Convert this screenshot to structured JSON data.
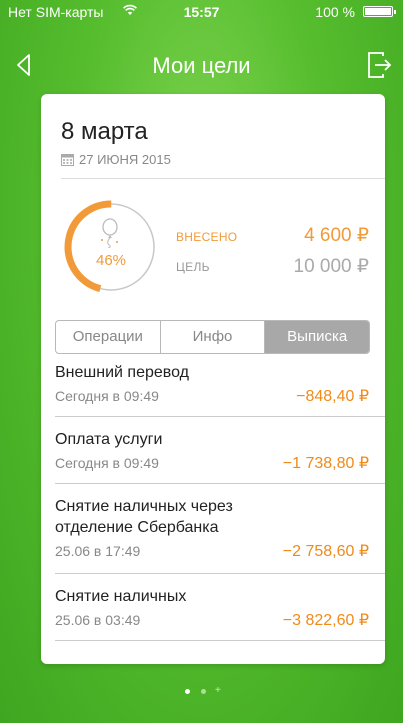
{
  "status_bar": {
    "carrier": "Нет SIM-карты",
    "time": "15:57",
    "battery": "100 %"
  },
  "nav": {
    "title": "Мои цели",
    "back_icon": "back-arrow-icon",
    "exit_icon": "exit-icon"
  },
  "goal": {
    "title": "8 марта",
    "date": "27 ИЮНЯ 2015",
    "progress_label": "46%",
    "progress_fraction": 0.46,
    "paid_label": "ВНЕСЕНО",
    "paid_value": "4 600 ₽",
    "target_label": "ЦЕЛЬ",
    "target_value": "10 000 ₽"
  },
  "tabs": [
    {
      "label": "Операции"
    },
    {
      "label": "Инфо"
    },
    {
      "label": "Выписка"
    }
  ],
  "operations": [
    {
      "name": "Внешний перевод",
      "time": "Сегодня в 09:49",
      "amount": "−848,40 ₽"
    },
    {
      "name": "Оплата услуги",
      "time": "Сегодня в 09:49",
      "amount": "−1 738,80 ₽"
    },
    {
      "name": "Снятие наличных через отделение Сбербанка",
      "time": "25.06 в 17:49",
      "amount": "−2 758,60 ₽"
    },
    {
      "name": "Снятие наличных",
      "time": "25.06 в 03:49",
      "amount": "−3 822,60 ₽"
    }
  ],
  "colors": {
    "accent": "#f29a38",
    "background": "#56bd2e"
  }
}
